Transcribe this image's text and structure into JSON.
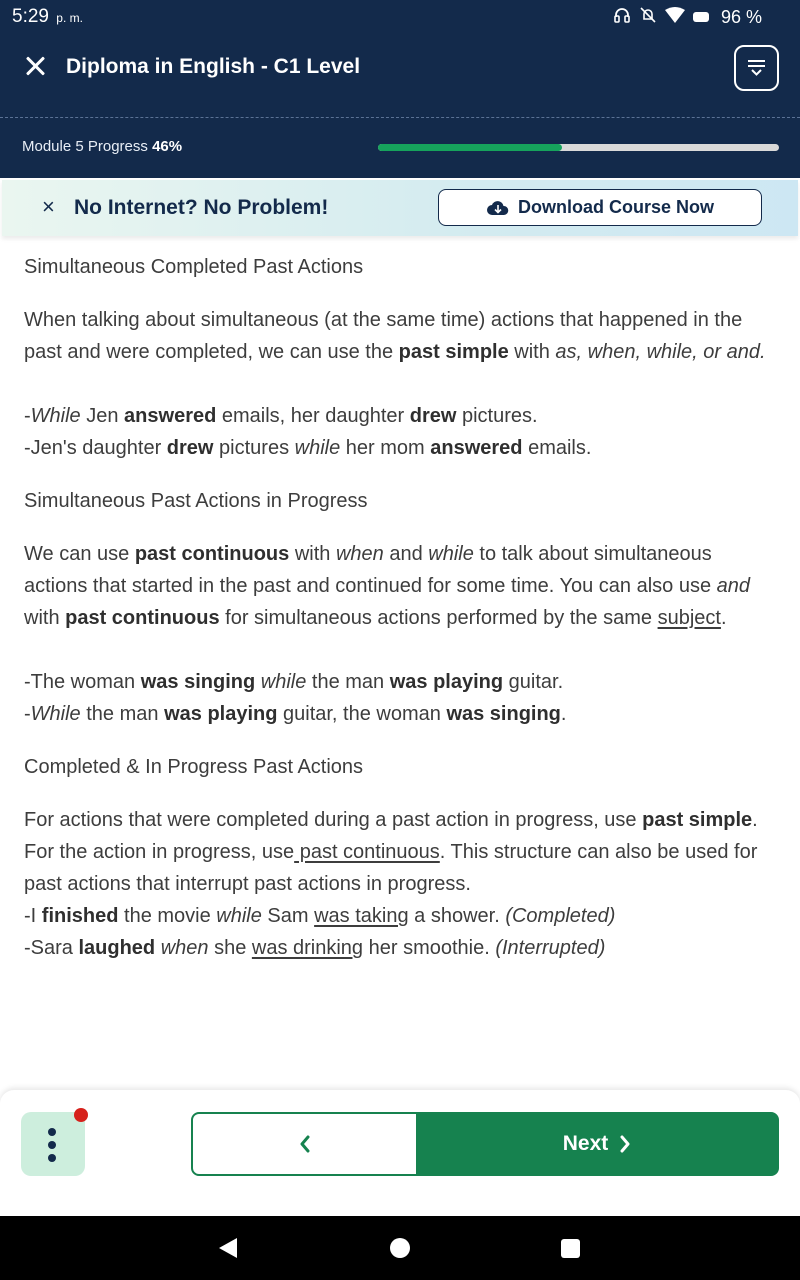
{
  "status_bar": {
    "time": "5:29",
    "time_suffix": "p. m.",
    "battery": "96 %",
    "icons": [
      "headset-icon",
      "notifications-off-icon",
      "wifi-icon",
      "battery-icon"
    ]
  },
  "header": {
    "title": "Diploma in English - C1 Level",
    "menu_icon": "menu-collapse-icon"
  },
  "progress": {
    "label": "Module 5 Progress",
    "percent_text": "46%",
    "fraction": 0.46,
    "fill_color": "#16a35c"
  },
  "offline_banner": {
    "message": "No Internet? No Problem!",
    "button_label": "Download Course Now"
  },
  "lesson": {
    "section1_title": "Simultaneous Completed Past Actions",
    "s1p1_a": "When talking about simultaneous (at the same time) actions that happened in the past and were completed, we can use the ",
    "s1p1_b": "past simple",
    "s1p1_c": " with ",
    "s1p1_d": "as, when, while, or and.",
    "s1e1_a": "-",
    "s1e1_b": "While",
    "s1e1_c": " Jen ",
    "s1e1_d": "answered",
    "s1e1_e": " emails, her daughter ",
    "s1e1_f": "drew",
    "s1e1_g": " pictures.",
    "s1e2_a": "-Jen's daughter ",
    "s1e2_b": "drew",
    "s1e2_c": " pictures ",
    "s1e2_d": "while",
    "s1e2_e": " her mom ",
    "s1e2_f": "answered",
    "s1e2_g": " emails.",
    "section2_title": "Simultaneous Past Actions in Progress",
    "s2p1_a": "We can use ",
    "s2p1_b": "past continuous",
    "s2p1_c": " with ",
    "s2p1_d": "when",
    "s2p1_e": " and ",
    "s2p1_f": "while",
    "s2p1_g": " to talk about simultaneous actions that started in the past and continued for some time. You can also use ",
    "s2p1_h": "and",
    "s2p1_i": " with ",
    "s2p1_j": "past continuous",
    "s2p1_k": " for simultaneous actions performed by the same ",
    "s2p1_l": "subject",
    "s2p1_m": ".",
    "s2e1_a": "-The woman ",
    "s2e1_b": "was singing",
    "s2e1_c": " ",
    "s2e1_d": "while",
    "s2e1_e": " the man ",
    "s2e1_f": "was playing",
    "s2e1_g": " guitar.",
    "s2e2_a": "-",
    "s2e2_b": "While",
    "s2e2_c": " the man ",
    "s2e2_d": "was playing",
    "s2e2_e": " guitar, the woman ",
    "s2e2_f": "was singing",
    "s2e2_g": ".",
    "section3_title": "Completed & In Progress Past Actions",
    "s3p1_a": "For actions that were completed during a past action in progress, use ",
    "s3p1_b": "past simple",
    "s3p1_c": ". For the action in progress, use",
    "s3p1_d": " past continuous",
    "s3p1_e": ". This structure can also be used for past actions that interrupt past actions in progress.",
    "s3e1_a": "-I ",
    "s3e1_b": "finished",
    "s3e1_c": " the movie ",
    "s3e1_d": "while",
    "s3e1_e": " Sam ",
    "s3e1_f": "was taking",
    "s3e1_g": " a shower. ",
    "s3e1_h": "(Completed)",
    "s3e2_a": "-Sara ",
    "s3e2_b": "laughed",
    "s3e2_c": " ",
    "s3e2_d": "when",
    "s3e2_e": " she ",
    "s3e2_f": "was drinking",
    "s3e2_g": " her smoothie. ",
    "s3e2_h": "(Interrupted)"
  },
  "bottom_bar": {
    "more_icon": "more-vertical-icon",
    "prev_icon": "chevron-left-icon",
    "next_label": "Next",
    "next_icon": "chevron-right-icon",
    "accent": "#16824f",
    "notification_dot_color": "#d6211b"
  }
}
